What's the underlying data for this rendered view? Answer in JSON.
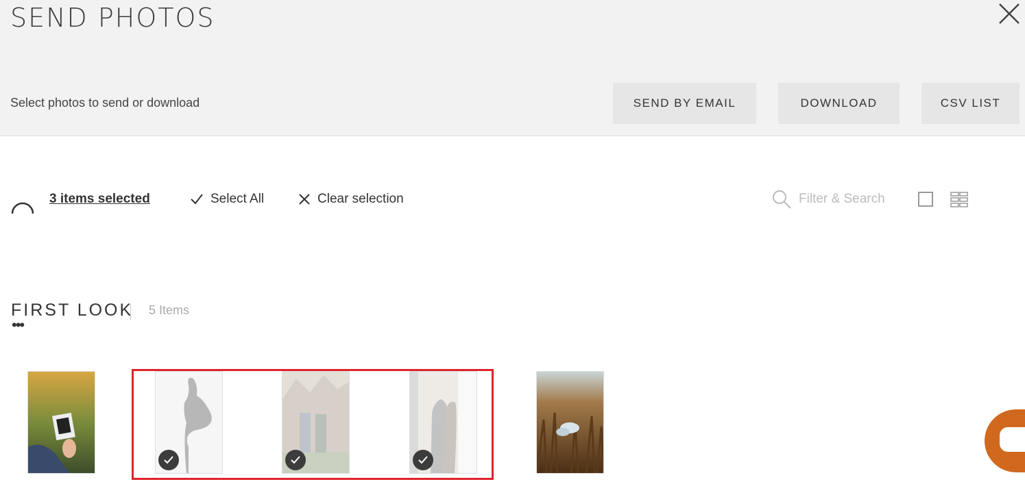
{
  "header": {
    "title": "SEND PHOTOS",
    "subtitle": "Select photos to send or download",
    "buttons": {
      "send_email": "SEND BY EMAIL",
      "download": "DOWNLOAD",
      "csv": "CSV LIST"
    }
  },
  "toolbar": {
    "selected_label": "3 items selected",
    "select_all": "Select All",
    "clear_selection": "Clear selection",
    "search_placeholder": "Filter & Search"
  },
  "section": {
    "title": "FIRST LOOK",
    "count": "5 Items",
    "more": "•••"
  },
  "photos": [
    {
      "subject": "ultrasound photo in hand",
      "selected": false
    },
    {
      "subject": "pregnant silhouette",
      "selected": true
    },
    {
      "subject": "couple outdoors",
      "selected": true
    },
    {
      "subject": "couple at window",
      "selected": true
    },
    {
      "subject": "baby shoes in wheat field",
      "selected": false
    }
  ],
  "colors": {
    "header_bg": "#f2f2f2",
    "button_bg": "#e6e6e6",
    "highlight": "#e0222b",
    "chat": "#d0691d",
    "check": "#3c3c3c"
  },
  "icons": [
    "close-icon",
    "spinner-icon",
    "check-icon",
    "x-icon",
    "search-icon",
    "single-view-icon",
    "grid-view-icon",
    "chat-icon"
  ]
}
